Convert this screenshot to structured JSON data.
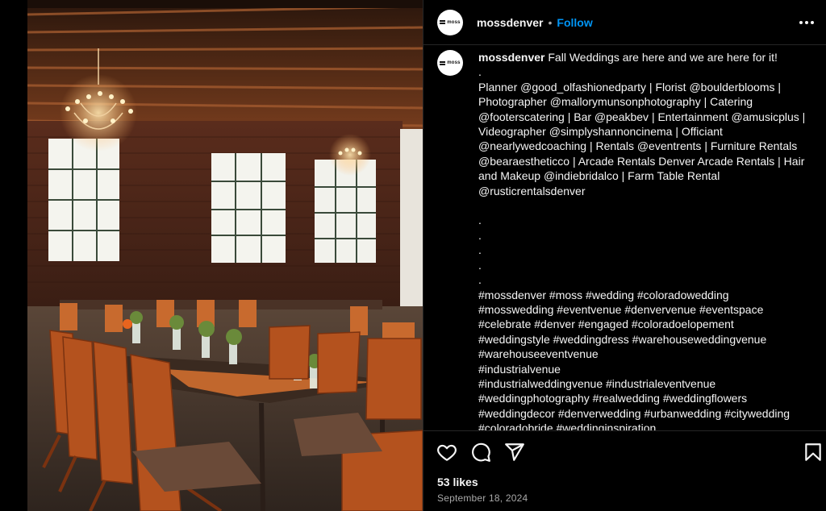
{
  "post": {
    "avatar_text": "moss",
    "username": "mossdenver",
    "separator": "•",
    "follow_label": "Follow",
    "more_icon": "more-horizontal-icon"
  },
  "caption": {
    "username": "mossdenver",
    "text": " Fall Weddings are here and we are here for it!\n.\nPlanner @good_olfashionedparty | Florist @boulderblooms | Photographer @mallorymunsonphotography | Catering @footerscatering | Bar @peakbev | Entertainment @amusicplus | Videographer @simplyshannoncinema | Officiant @nearlywedcoaching | Rentals @eventrents | Furniture Rentals @bearaestheticco | Arcade Rentals Denver Arcade Rentals | Hair and Makeup @indiebridalco | Farm Table Rental @rusticrentalsdenver\n\n.\n.\n.\n.\n.\n#mossdenver #moss #wedding #coloradowedding\n#mosswedding #eventvenue #denvervenue #eventspace\n#celebrate #denver #engaged #coloradoelopement\n#weddingstyle #weddingdress #warehouseweddingvenue\n#warehouseeventvenue\n#industrialvenue\n#industrialweddingvenue #industrialeventvenue\n#weddingphotography #realwedding #weddingflowers\n#weddingdecor #denverwedding #urbanwedding #citywedding\n#coloradobride #weddinginspiration"
  },
  "actions": {
    "icons": [
      "heart-icon",
      "comment-icon",
      "share-icon",
      "bookmark-icon"
    ]
  },
  "stats": {
    "likes": "53 likes",
    "date": "September 18, 2024"
  },
  "colors": {
    "background": "#000000",
    "text": "#f5f5f5",
    "follow": "#0095f6",
    "secondary": "#a8a8a8",
    "divider": "#262626"
  }
}
